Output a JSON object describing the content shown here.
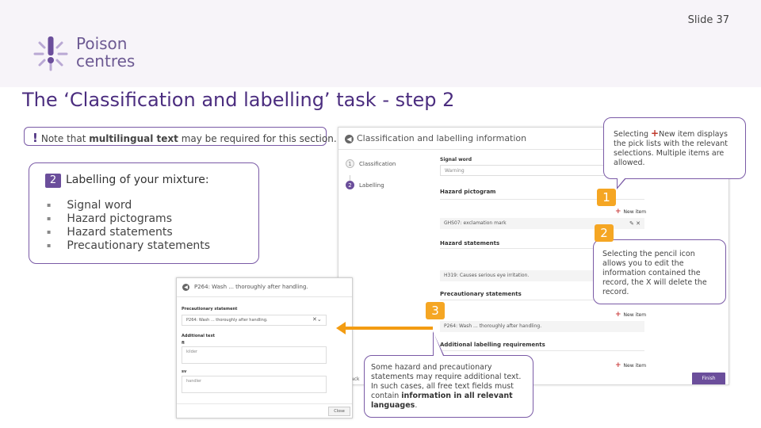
{
  "slide": {
    "number_label": "Slide 37",
    "logo_line1": "Poison",
    "logo_line2": "centres",
    "title": "The ‘Classification and labelling’ task - step 2"
  },
  "note": {
    "bang": "!",
    "prefix": "Note that ",
    "bold": "multilingual text",
    "suffix": " may be required for this section."
  },
  "labelling": {
    "badge": "2",
    "heading": "Labelling of your mixture",
    "colon": ":",
    "items": [
      "Signal word",
      "Hazard pictograms",
      "Hazard statements",
      "Precautionary statements"
    ]
  },
  "screen_main": {
    "header_title": "Classification and labelling information",
    "steps": [
      {
        "num": "1",
        "label": "Classification"
      },
      {
        "num": "2",
        "label": "Labelling"
      }
    ],
    "signal_word_label": "Signal word",
    "signal_word_value": "Warning",
    "hazard_pictogram_title": "Hazard pictogram",
    "new_item_label": "New item",
    "pictogram_row": "GHS07: exclamation mark",
    "hazard_statements_title": "Hazard statements",
    "hazard_row": "H319: Causes serious eye irritation.",
    "precautionary_title": "Precautionary statements",
    "precautionary_row": "P264: Wash ... thoroughly after handling.",
    "additional_title": "Additional labelling requirements",
    "left_cut_text": "ack",
    "finish_label": "Finish"
  },
  "screen_detail": {
    "header_title": "P264: Wash ... thoroughly after handling.",
    "precautionary_label": "Precautionary statement",
    "precautionary_value": "P264: Wash ... thoroughly after handling.",
    "additional_label": "Additional text",
    "lang1": "fi",
    "lang1_placeholder": "kilder",
    "lang2": "sv",
    "lang2_placeholder": "handler",
    "close_label": "Close"
  },
  "callouts": {
    "c1_before": "Selecting ",
    "c1_plus": "+",
    "c1_after": "New item displays the pick lists with the relevant selections. Multiple items are allowed.",
    "c2": "Selecting the pencil icon allows you to edit the information contained the record, the X will delete the record.",
    "c3_before": "Some hazard and precautionary statements may require additional text. In such cases, all free text fields must contain ",
    "c3_bold": "information in all relevant languages",
    "c3_after": "."
  },
  "markers": [
    "1",
    "2",
    "3"
  ],
  "colors": {
    "brand_purple": "#6b4e9b",
    "title_purple": "#4b2d7f",
    "marker_orange": "#f5a623",
    "arrow_orange": "#f39c12"
  }
}
